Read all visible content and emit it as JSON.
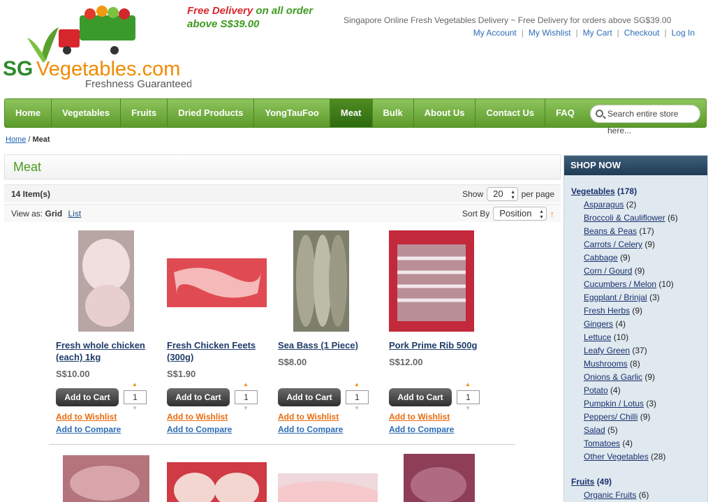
{
  "header": {
    "logo_text": "SGVegetables.com",
    "logo_tagline": "Freshness Guaranteed",
    "promo_line1_red": "Free Delivery",
    "promo_line1_green": " on all order",
    "promo_line2": "above S$39.00",
    "tagline": "Singapore Online Fresh Vegetables Delivery ~ Free Delivery for orders above SG$39.00",
    "links": [
      "My Account",
      "My Wishlist",
      "My Cart",
      "Checkout",
      "Log In"
    ]
  },
  "nav": {
    "items": [
      "Home",
      "Vegetables",
      "Fruits",
      "Dried Products",
      "YongTauFoo",
      "Meat",
      "Bulk",
      "About Us",
      "Contact Us",
      "FAQ"
    ],
    "active": "Meat",
    "search_placeholder": "Search entire store here..."
  },
  "breadcrumb": {
    "home": "Home",
    "sep": " / ",
    "current": "Meat"
  },
  "page_title": "Meat",
  "toolbar": {
    "item_count": "14 Item(s)",
    "show_label": "Show",
    "show_value": "20",
    "per_page": "per page",
    "view_as": "View as:",
    "view_grid": "Grid",
    "view_list": "List",
    "sort_label": "Sort By",
    "sort_value": "Position"
  },
  "products": [
    {
      "name": "Fresh whole chicken (each) 1kg",
      "price": "S$10.00",
      "qty": "1"
    },
    {
      "name": "Fresh Chicken Feets (300g)",
      "price": "S$1.90",
      "qty": "1"
    },
    {
      "name": "Sea Bass (1 Piece)",
      "price": "S$8.00",
      "qty": "1"
    },
    {
      "name": "Pork Prime Rib 500g",
      "price": "S$12.00",
      "qty": "1"
    }
  ],
  "product_actions": {
    "add_to_cart": "Add to Cart",
    "wishlist": "Add to Wishlist",
    "compare": "Add to Compare"
  },
  "sidebar": {
    "title": "SHOP NOW",
    "vegetables": {
      "label": "Vegetables",
      "count": "(178)"
    },
    "veg_subs": [
      {
        "label": "Asparagus",
        "count": "(2)"
      },
      {
        "label": "Broccoli & Cauliflower",
        "count": "(6)"
      },
      {
        "label": "Beans & Peas",
        "count": "(17)"
      },
      {
        "label": "Carrots / Celery",
        "count": "(9)"
      },
      {
        "label": "Cabbage",
        "count": "(9)"
      },
      {
        "label": "Corn / Gourd",
        "count": "(9)"
      },
      {
        "label": "Cucumbers / Melon",
        "count": "(10)"
      },
      {
        "label": "Eggplant / Brinjal",
        "count": "(3)"
      },
      {
        "label": "Fresh Herbs",
        "count": "(9)"
      },
      {
        "label": "Gingers",
        "count": "(4)"
      },
      {
        "label": "Lettuce",
        "count": "(10)"
      },
      {
        "label": "Leafy Green",
        "count": "(37)"
      },
      {
        "label": "Mushrooms",
        "count": "(8)"
      },
      {
        "label": "Onions & Garlic",
        "count": "(9)"
      },
      {
        "label": "Potato",
        "count": "(4)"
      },
      {
        "label": "Pumpkin / Lotus",
        "count": "(3)"
      },
      {
        "label": "Peppers/ Chilli",
        "count": "(9)"
      },
      {
        "label": "Salad",
        "count": "(5)"
      },
      {
        "label": "Tomatoes",
        "count": "(4)"
      },
      {
        "label": "Other Vegetables",
        "count": "(28)"
      }
    ],
    "fruits": {
      "label": "Fruits",
      "count": "(49)"
    },
    "fruit_subs": [
      {
        "label": "Organic Fruits",
        "count": "(6)"
      }
    ]
  }
}
